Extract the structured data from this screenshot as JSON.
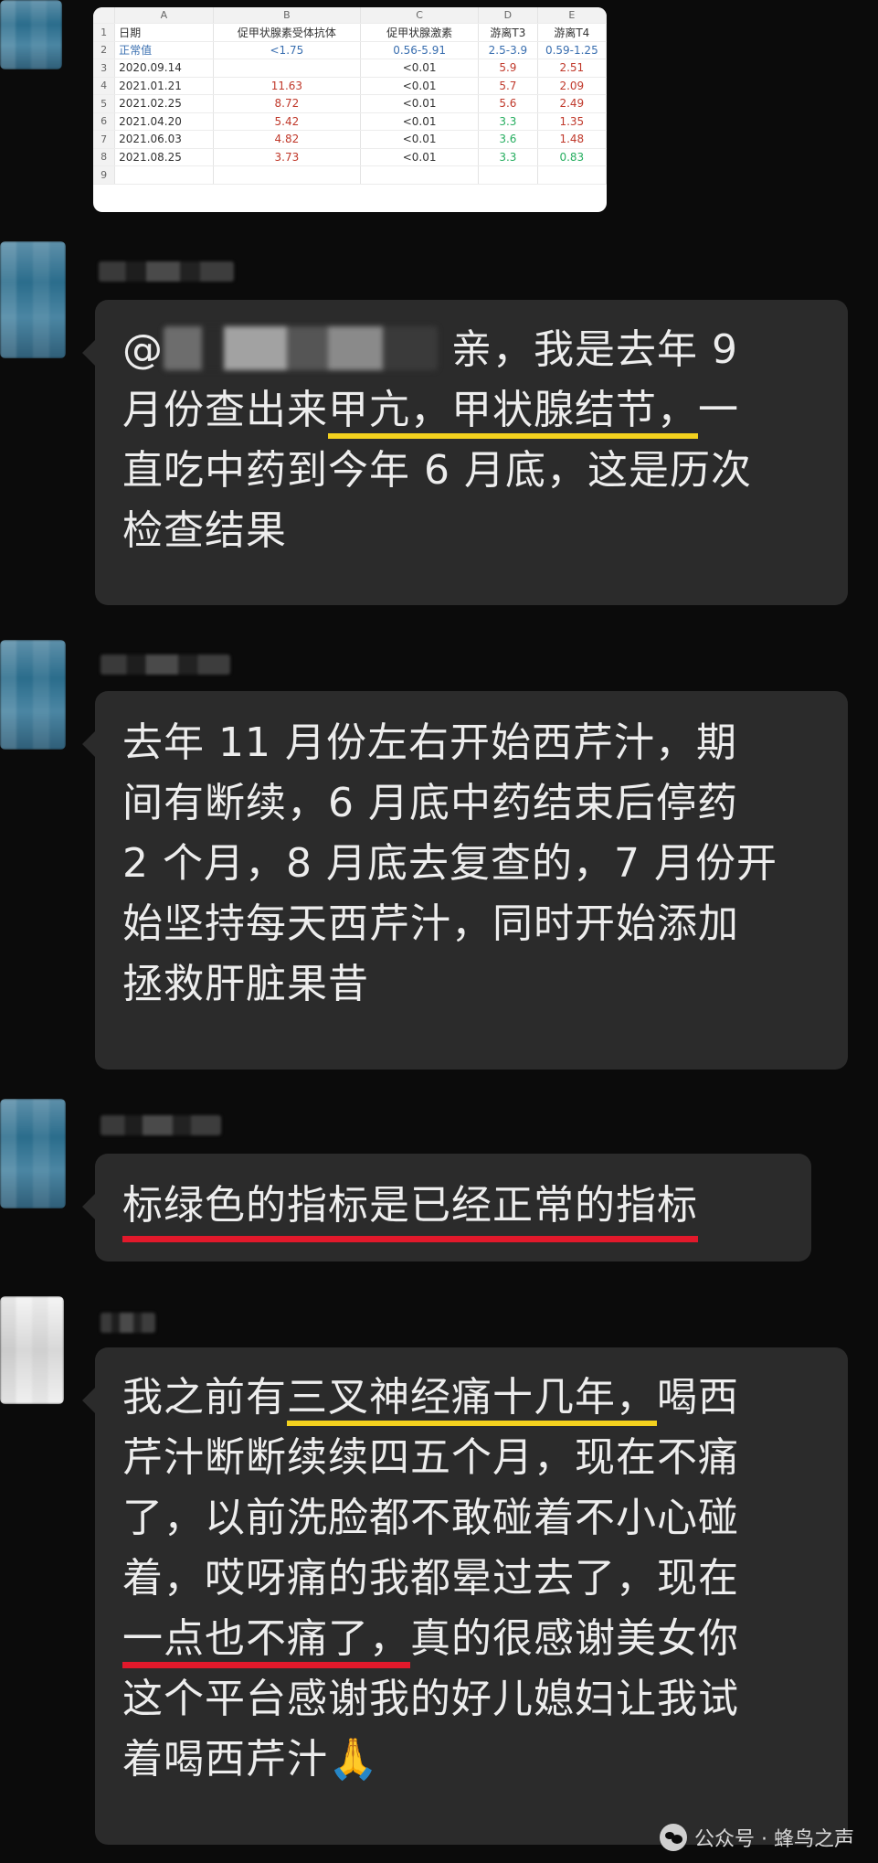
{
  "spreadsheet": {
    "columns": [
      "A",
      "B",
      "C",
      "D",
      "E"
    ],
    "header_row": [
      "日期",
      "促甲状腺素受体抗体",
      "促甲状腺激素",
      "游离T3",
      "游离T4"
    ],
    "reference_row": [
      "正常值",
      "<1.75",
      "0.56-5.91",
      "2.5-3.9",
      "0.59-1.25"
    ],
    "rows": [
      {
        "n": "3",
        "date": "2020.09.14",
        "b": "",
        "c": "<0.01",
        "d": "5.9",
        "e": "2.51"
      },
      {
        "n": "4",
        "date": "2021.01.21",
        "b": "11.63",
        "c": "<0.01",
        "d": "5.7",
        "e": "2.09"
      },
      {
        "n": "5",
        "date": "2021.02.25",
        "b": "8.72",
        "c": "<0.01",
        "d": "5.6",
        "e": "2.49"
      },
      {
        "n": "6",
        "date": "2021.04.20",
        "b": "5.42",
        "c": "<0.01",
        "d": "3.3",
        "e": "1.35"
      },
      {
        "n": "7",
        "date": "2021.06.03",
        "b": "4.82",
        "c": "<0.01",
        "d": "3.6",
        "e": "1.48"
      },
      {
        "n": "8",
        "date": "2021.08.25",
        "b": "3.73",
        "c": "<0.01",
        "d": "3.3",
        "e": "0.83"
      }
    ],
    "row_numbers": [
      "1",
      "2",
      "9"
    ]
  },
  "messages": [
    {
      "lines": [
        {
          "pre": "@",
          "post": " 亲，我是去年 9"
        },
        {
          "pre": "月份查出来",
          "hl": "甲亢，甲状腺结节，",
          "post": "一"
        },
        {
          "text": "直吃中药到今年 6 月底，这是历次"
        },
        {
          "text": "检查结果"
        }
      ]
    },
    {
      "lines": [
        "去年 11 月份左右开始西芹汁，期",
        "间有断续，6 月底中药结束后停药",
        "2 个月，8 月底去复查的，7 月份开",
        "始坚持每天西芹汁，同时开始添加",
        "拯救肝脏果昔"
      ]
    },
    {
      "text": "标绿色的指标是已经正常的指标"
    },
    {
      "lines": [
        {
          "pre": "我之前有",
          "hl": "三叉神经痛十几年，",
          "post": "喝西"
        },
        {
          "text": "芹汁断断续续四五个月，现在不痛"
        },
        {
          "text": "了，以前洗脸都不敢碰着不小心碰"
        },
        {
          "text": "着，哎呀痛的我都晕过去了，现在"
        },
        {
          "hl_red": "一点也不痛了，",
          "post": "真的很感谢美女你"
        },
        {
          "text": "这个平台感谢我的好儿媳妇让我试"
        },
        {
          "text": "着喝西芹汁🙏"
        }
      ]
    }
  ],
  "watermark": {
    "label": "公众号 · 蜂鸟之声",
    "icon": "wechat-icon"
  }
}
